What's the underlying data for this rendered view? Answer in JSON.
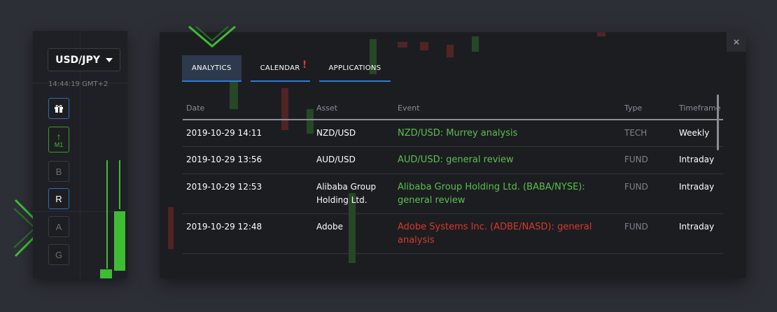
{
  "sidebar": {
    "asset": "USD/JPY",
    "time": "14:44:19 GMT+2",
    "tools": [
      {
        "label": "M1"
      },
      {
        "label": "B"
      },
      {
        "label": "R"
      },
      {
        "label": "A"
      },
      {
        "label": "G"
      }
    ]
  },
  "tabs": [
    {
      "label": "ANALYTICS"
    },
    {
      "label": "CALENDAR",
      "alert": "!"
    },
    {
      "label": "APPLICATIONS"
    }
  ],
  "close_label": "×",
  "table": {
    "columns": [
      "Date",
      "Asset",
      "Event",
      "Type",
      "Timeframe"
    ],
    "rows": [
      {
        "date": "2019-10-29 14:11",
        "asset": "NZD/USD",
        "event": "NZD/USD: Murrey analysis",
        "sentiment": "positive",
        "type": "TECH",
        "timeframe": "Weekly"
      },
      {
        "date": "2019-10-29 13:56",
        "asset": "AUD/USD",
        "event": "AUD/USD: general review",
        "sentiment": "positive",
        "type": "FUND",
        "timeframe": "Intraday"
      },
      {
        "date": "2019-10-29 12:53",
        "asset": "Alibaba Group Holding Ltd.",
        "event": "Alibaba Group Holding Ltd. (BABA/NYSE): general review",
        "sentiment": "positive",
        "type": "FUND",
        "timeframe": "Intraday"
      },
      {
        "date": "2019-10-29 12:48",
        "asset": "Adobe",
        "event": "Adobe Systems Inc. (ADBE/NASD): general analysis",
        "sentiment": "negative",
        "type": "FUND",
        "timeframe": "Intraday"
      }
    ]
  },
  "colors": {
    "positive": "#5cbf4f",
    "negative": "#d63a2c",
    "accent_blue": "#2f7bd1",
    "accent_green": "#3ebc34"
  }
}
